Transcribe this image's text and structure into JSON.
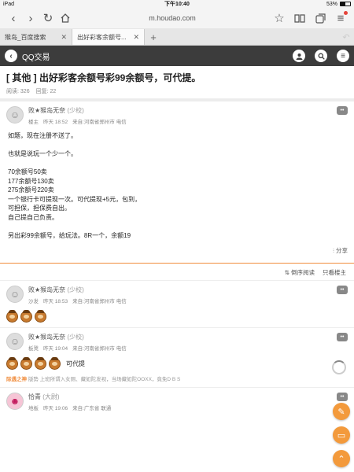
{
  "status": {
    "device": "iPad",
    "time": "下午10:40",
    "battery": "53%"
  },
  "browser": {
    "url": "m.houdao.com"
  },
  "tabs": [
    {
      "label": "猴岛_百度搜索"
    },
    {
      "label": "出好彩客余额号..."
    }
  ],
  "site": {
    "title": "QQ交易"
  },
  "thread": {
    "category": "[ 其他 ]",
    "title": " 出好彩客余额号彩99余额号，可代提。",
    "views_label": "阅读:",
    "views": "326",
    "replies_label": "回复:",
    "replies": "22"
  },
  "main_post": {
    "user": "败★猴岛无奈",
    "level": "(少校)",
    "floor": "楼主",
    "time": "昨天 18:52",
    "location": "来自:河南省郑州市 电信",
    "lines": [
      "如题，现在注册不送了。",
      "",
      "也就是说玩一个少一个。",
      "",
      "70余额号50卖",
      "177余额号130卖",
      "275余额号220卖",
      "一个银行卡可提现一次。可代提现+5元，包到，",
      "可担保，担保费自出。",
      "自己提自己负责。",
      "",
      "另出彩99余额号，给玩法。8R一个，余额19"
    ],
    "share": "分享"
  },
  "sort": {
    "reverse": "倒序阅读",
    "op_only": "只看楼主"
  },
  "replies": [
    {
      "user": "败★猴岛无奈",
      "level": "(少校)",
      "floor": "沙发",
      "time": "昨天 18:53",
      "location": "来自:河南省郑州市 电信",
      "emoji_count": 3,
      "text": ""
    },
    {
      "user": "败★猴岛无奈",
      "level": "(少校)",
      "floor": "板凳",
      "time": "昨天 19:04",
      "location": "来自:河南省郑州市 电信",
      "emoji_count": 4,
      "text": "可代提",
      "sig_tag": "际遇之神",
      "sig_text": "版勢 上班所谓入女厕、藏如陀发视，当场藏如陀OOXX，竟免D B S"
    },
    {
      "user": "恰青",
      "level": "(大尉)",
      "floor": "地板",
      "time": "昨天 19:06",
      "location": "来自:广东省 联通"
    }
  ],
  "colors": {
    "accent": "#f39a3c",
    "header_bg": "#3c3c3c"
  }
}
